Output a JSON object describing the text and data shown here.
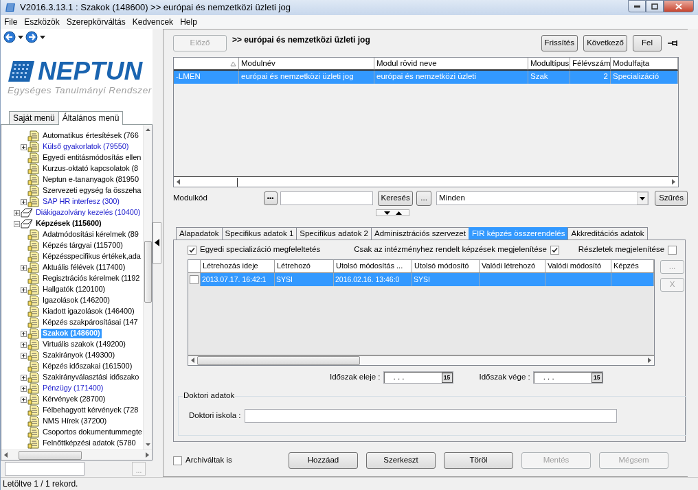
{
  "window": {
    "title": "V2016.3.13.1 : Szakok (148600)  >> európai és nemzetközi üzleti jog"
  },
  "menu": [
    "File",
    "Eszközök",
    "Szerepkörváltás",
    "Kedvencek",
    "Help"
  ],
  "logo": {
    "name": "NEPTUN",
    "subtitle": "Egységes Tanulmányi Rendszer"
  },
  "menu_tabs": [
    {
      "label": "Saját menü",
      "selected": false
    },
    {
      "label": "Általános menü",
      "selected": true
    }
  ],
  "tree": {
    "continued": [
      {
        "label": "Automatikus értesítések (766",
        "kind": "form",
        "selected": false
      },
      {
        "label": "Külső gyakorlatok (79550)",
        "kind": "form",
        "selected": false,
        "expanded": false,
        "color": "#1a1acc"
      },
      {
        "label": "Egyedi entitásmódosítás ellen",
        "kind": "form",
        "selected": false
      },
      {
        "label": "Kurzus-oktató kapcsolatok (8",
        "kind": "form",
        "selected": false
      },
      {
        "label": "Neptun e-tananyagok (81950",
        "kind": "form",
        "selected": false
      },
      {
        "label": "Szervezeti egység fa összeha",
        "kind": "form",
        "selected": false
      },
      {
        "label": "SAP HR interfesz (300)",
        "kind": "form",
        "selected": false,
        "expanded": false,
        "color": "#1a1acc"
      }
    ],
    "nodes": [
      {
        "label": "Diákigazolvány kezelés (10400)",
        "kind": "folder",
        "selected": false,
        "expanded": false,
        "color": "#1a1acc"
      },
      {
        "label": "Képzések (115600)",
        "kind": "folder",
        "selected": false,
        "expanded": true,
        "children": [
          {
            "label": "Adatmódosítási kérelmek (89",
            "kind": "form",
            "selected": false
          },
          {
            "label": "Képzés tárgyai (115700)",
            "kind": "form",
            "selected": false
          },
          {
            "label": "Képzésspecifikus értékek,ada",
            "kind": "form",
            "selected": false
          },
          {
            "label": "Aktuális félévek (117400)",
            "kind": "form",
            "selected": false,
            "expanded": false
          },
          {
            "label": "Regisztrációs kérelmek (1192",
            "kind": "form",
            "selected": false
          },
          {
            "label": "Hallgatók (120100)",
            "kind": "form",
            "selected": false,
            "expanded": false
          },
          {
            "label": "Igazolások (146200)",
            "kind": "form",
            "selected": false
          },
          {
            "label": "Kiadott igazolások (146400)",
            "kind": "form",
            "selected": false
          },
          {
            "label": "Képzés szakpárosításai (147",
            "kind": "form",
            "selected": false
          },
          {
            "label": "Szakok (148600)",
            "kind": "form",
            "selected": true,
            "expanded": false
          },
          {
            "label": "Virtuális szakok (149200)",
            "kind": "form",
            "selected": false,
            "expanded": false
          },
          {
            "label": "Szakirányok (149300)",
            "kind": "form",
            "selected": false,
            "expanded": false
          },
          {
            "label": "Képzés időszakai (161500)",
            "kind": "form",
            "selected": false
          },
          {
            "label": "Szakirányválasztási időszako",
            "kind": "form",
            "selected": false,
            "expanded": false
          },
          {
            "label": "Pénzügy (171400)",
            "kind": "form",
            "selected": false,
            "expanded": false,
            "color": "#1a1acc"
          },
          {
            "label": "Kérvények (28700)",
            "kind": "form",
            "selected": false,
            "expanded": false
          },
          {
            "label": "Félbehagyott kérvények (728",
            "kind": "form",
            "selected": false
          },
          {
            "label": "NMS Hírek (37200)",
            "kind": "form",
            "selected": false
          },
          {
            "label": "Csoportos dokumentummegte",
            "kind": "form",
            "selected": false
          },
          {
            "label": "Felnőttképzési adatok (5780",
            "kind": "form",
            "selected": false
          }
        ]
      }
    ]
  },
  "tree_search": {
    "button": "...",
    "disabled": true
  },
  "toolbar": {
    "prev_button": {
      "label": "Előző",
      "disabled": true
    },
    "heading": ">> európai és nemzetközi üzleti jog",
    "buttons": [
      "Frissítés",
      "Következő",
      "Fel"
    ]
  },
  "module_table": {
    "columns": [
      {
        "sorted": true
      },
      {
        "label": "Modulnév"
      },
      {
        "label": "Modul rövid neve"
      },
      {
        "label": "Modultípus"
      },
      {
        "label": "Félévszám"
      },
      {
        "label": "Modulfajta"
      }
    ],
    "rows": [
      {
        "selected": true,
        "cells": [
          "-LMEN",
          "európai és nemzetközi üzleti jog",
          "európai és nemzetközi üzleti",
          "Szak",
          "2",
          "Specializáció"
        ]
      }
    ]
  },
  "filter": {
    "label": "Modulkód",
    "dots_button": "•••",
    "search_button": "Keresés",
    "more_button": "...",
    "dropdown": "Minden",
    "filter_button": "Szűrés"
  },
  "detail_tabs": [
    {
      "label": "Alapadatok",
      "selected": false
    },
    {
      "label": "Specifikus adatok 1",
      "selected": false
    },
    {
      "label": "Specifikus adatok 2",
      "selected": false
    },
    {
      "label": "Adminisztrációs szervezet",
      "selected": false
    },
    {
      "label": "FIR képzés összerendelés",
      "selected": true
    },
    {
      "label": "Akkreditációs adatok",
      "selected": false
    }
  ],
  "options": [
    {
      "label": "Egyedi specializáció megfeleltetés",
      "checked": true,
      "kind": "box_first"
    },
    {
      "label": "Csak az intézményhez rendelt képzések megjelenítése",
      "checked": true,
      "kind": "label_first"
    },
    {
      "label": "Részletek megjelenítése",
      "checked": false,
      "kind": "label_first"
    }
  ],
  "fir_table": {
    "columns": [
      {
        "label": "Létrehozás ideje"
      },
      {
        "label": "Létrehozó"
      },
      {
        "label": "Utolsó módosítás ..."
      },
      {
        "label": "Utolsó módosító"
      },
      {
        "label": "Valódi létrehozó"
      },
      {
        "label": "Valódi módosító"
      },
      {
        "label": "Képzés"
      }
    ],
    "rows": [
      {
        "selected": true,
        "checked": false,
        "cells": [
          "2013.07.17. 16:42:1",
          "SYSI",
          "2016.02.16. 13:46:0",
          "SYSI"
        ]
      }
    ],
    "side_buttons": [
      {
        "label": "...",
        "disabled": true
      },
      {
        "label": "X",
        "disabled": true
      }
    ]
  },
  "period": [
    {
      "label": "Időszak eleje :",
      "value": ". . .",
      "calendar": "15"
    },
    {
      "label": "Időszak vége :",
      "value": ". . .",
      "calendar": "15"
    }
  ],
  "doctoral": {
    "title": "Doktori adatok",
    "field_label": "Doktori iskola :"
  },
  "archived": {
    "label": "Archiváltak is",
    "checked": false
  },
  "actions": [
    {
      "label": "Hozzáad",
      "disabled": false
    },
    {
      "label": "Szerkeszt",
      "disabled": false
    },
    {
      "label": "Töröl",
      "disabled": false
    },
    {
      "label": "Mentés",
      "disabled": true
    },
    {
      "label": "Mégsem",
      "disabled": true
    }
  ],
  "status_bar": "Letöltve 1 / 1 rekord."
}
